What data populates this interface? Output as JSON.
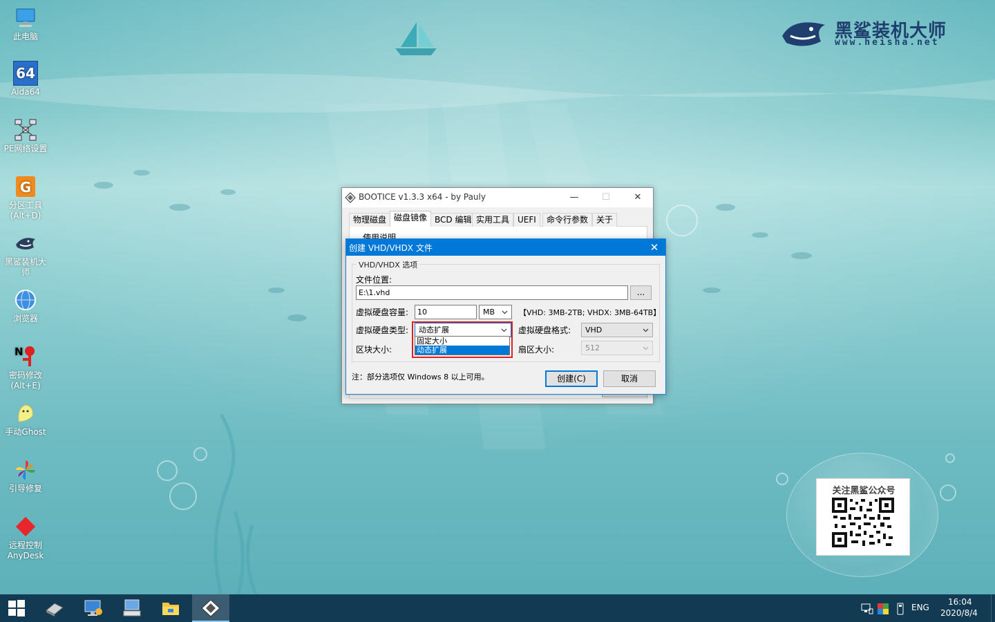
{
  "desktop": {
    "icons": [
      {
        "label": "此电脑",
        "sub": ""
      },
      {
        "label": "Aida64",
        "sub": ""
      },
      {
        "label": "PE网络设置",
        "sub": ""
      },
      {
        "label": "分区工具",
        "sub": "(Alt+D)"
      },
      {
        "label": "黑鲨装机大",
        "sub": "师"
      },
      {
        "label": "浏览器",
        "sub": ""
      },
      {
        "label": "密码修改",
        "sub": "(Alt+E)"
      },
      {
        "label": "手动Ghost",
        "sub": ""
      },
      {
        "label": "引导修复",
        "sub": ""
      },
      {
        "label": "远程控制",
        "sub": "AnyDesk"
      }
    ],
    "aida_badge": "64",
    "logo": {
      "title": "黑鲨装机大师",
      "url": "www.heisha.net"
    },
    "qr": {
      "title": "关注黑鲨公众号"
    }
  },
  "bootice": {
    "title": "BOOTICE v1.3.3 x64 - by Pauly",
    "minimize": "—",
    "maximize": "☐",
    "close": "✕",
    "tabs": [
      "物理磁盘",
      "磁盘镜像",
      "BCD 编辑",
      "实用工具",
      "UEFI",
      "命令行参数",
      "关于"
    ],
    "active_tab": 1,
    "behind_label": "使用说明"
  },
  "vhd_dialog": {
    "title": "创建 VHD/VHDX 文件",
    "close": "✕",
    "group_label": "VHD/VHDX 选项",
    "file_location_label": "文件位置:",
    "file_location_value": "E:\\1.vhd",
    "browse_label": "...",
    "capacity_label": "虚拟硬盘容量:",
    "capacity_value": "10",
    "capacity_unit": "MB",
    "capacity_hint": "【VHD: 3MB-2TB; VHDX: 3MB-64TB】",
    "type_label": "虚拟硬盘类型:",
    "type_value": "动态扩展",
    "type_options": [
      "固定大小",
      "动态扩展"
    ],
    "type_selected_index": 1,
    "format_label": "虚拟硬盘格式:",
    "format_value": "VHD",
    "block_label": "区块大小:",
    "sector_label": "扇区大小:",
    "sector_value": "512",
    "note": "注：部分选项仅 Windows 8 以上可用。",
    "create_button": "创建(C)",
    "cancel_button": "取消"
  },
  "taskbar": {
    "ime": "ENG",
    "time": "16:04",
    "date": "2020/8/4"
  },
  "colors": {
    "accent": "#0078d7",
    "highlight_box": "#e02020",
    "taskbar": "#123a52"
  }
}
